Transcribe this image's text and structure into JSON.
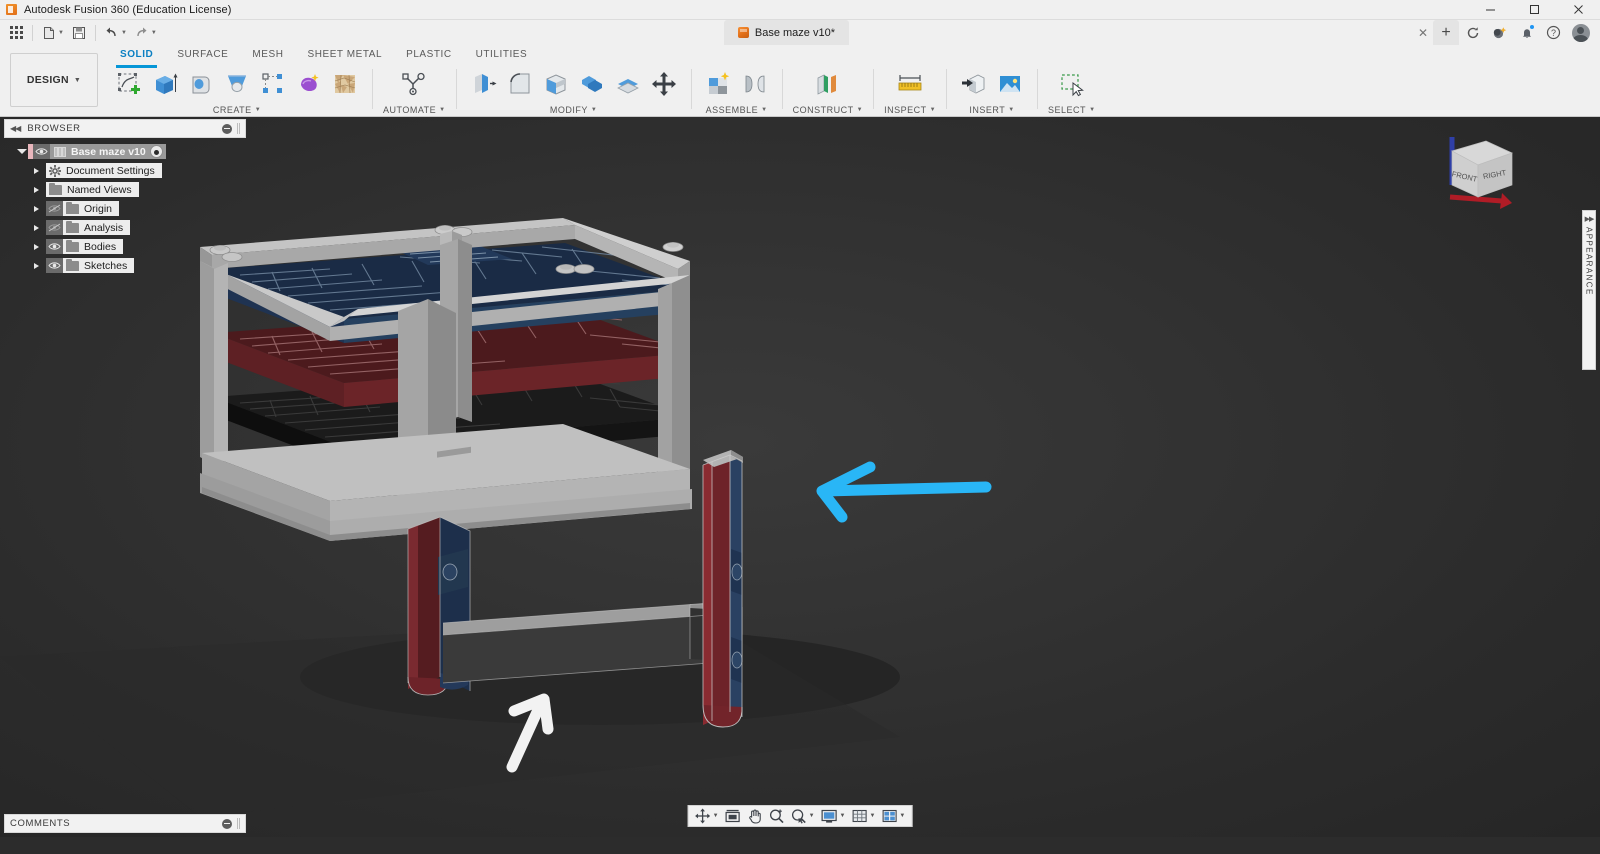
{
  "window": {
    "title": "Autodesk Fusion 360 (Education License)",
    "app_icon": "fusion-cube-icon",
    "minimize": "─",
    "maximize": "□",
    "close": "✕"
  },
  "quick_access": {
    "grid_icon": "app-grid-icon",
    "new_icon": "new-document-icon",
    "save_icon": "save-icon",
    "undo_icon": "undo-icon",
    "redo_icon": "redo-icon",
    "caret": "▼"
  },
  "document_tab": {
    "label": "Base maze v10*",
    "icon": "fusion-cube-icon",
    "close": "✕",
    "new_tab": "+"
  },
  "header_icons": [
    {
      "name": "refresh-icon",
      "label": "Refresh"
    },
    {
      "name": "extensions-icon",
      "label": "Extensions"
    },
    {
      "name": "notifications-bell-icon",
      "label": "Notifications",
      "badge": true
    },
    {
      "name": "help-icon",
      "label": "Help"
    },
    {
      "name": "user-avatar",
      "label": "Account"
    }
  ],
  "workspace_switcher": {
    "label": "DESIGN",
    "caret": "▼"
  },
  "ribbon": {
    "tabs": [
      {
        "label": "SOLID",
        "active": true
      },
      {
        "label": "SURFACE",
        "active": false
      },
      {
        "label": "MESH",
        "active": false
      },
      {
        "label": "SHEET METAL",
        "active": false
      },
      {
        "label": "PLASTIC",
        "active": false
      },
      {
        "label": "UTILITIES",
        "active": false
      }
    ],
    "panels": [
      {
        "label": "CREATE",
        "caret": "▼",
        "tools": [
          {
            "name": "create-sketch-icon"
          },
          {
            "name": "extrude-icon"
          },
          {
            "name": "revolve-icon"
          },
          {
            "name": "loft-icon"
          },
          {
            "name": "pattern-icon"
          },
          {
            "name": "create-form-icon"
          },
          {
            "name": "create-mesh-icon"
          }
        ]
      },
      {
        "label": "AUTOMATE",
        "caret": "▼",
        "tools": [
          {
            "name": "automate-icon"
          }
        ]
      },
      {
        "label": "MODIFY",
        "caret": "▼",
        "tools": [
          {
            "name": "press-pull-icon"
          },
          {
            "name": "fillet-icon"
          },
          {
            "name": "shell-icon"
          },
          {
            "name": "combine-icon"
          },
          {
            "name": "offset-face-icon"
          },
          {
            "name": "move-copy-icon"
          }
        ]
      },
      {
        "label": "ASSEMBLE",
        "caret": "▼",
        "tools": [
          {
            "name": "new-component-icon"
          },
          {
            "name": "joint-icon"
          }
        ]
      },
      {
        "label": "CONSTRUCT",
        "caret": "▼",
        "tools": [
          {
            "name": "construct-plane-icon"
          }
        ]
      },
      {
        "label": "INSPECT",
        "caret": "▼",
        "tools": [
          {
            "name": "measure-icon"
          }
        ]
      },
      {
        "label": "INSERT",
        "caret": "▼",
        "tools": [
          {
            "name": "insert-derive-icon"
          },
          {
            "name": "insert-image-icon"
          }
        ]
      },
      {
        "label": "SELECT",
        "caret": "▼",
        "tools": [
          {
            "name": "select-window-icon"
          }
        ]
      }
    ]
  },
  "browser": {
    "title": "BROWSER",
    "collapse_icon": "◀◀",
    "minimize_icon": "panel-minimize-icon",
    "grip_icon": "panel-grip-icon",
    "root": {
      "label": "Base maze v10",
      "expanded": true,
      "visible": true,
      "icon": "component-icon",
      "activate_icon": "activate-radio-icon"
    },
    "items": [
      {
        "label": "Document Settings",
        "icon": "gear-icon",
        "visible": null,
        "expanded": false
      },
      {
        "label": "Named Views",
        "icon": "folder-icon",
        "visible": null,
        "expanded": false
      },
      {
        "label": "Origin",
        "icon": "folder-icon",
        "visible": false,
        "expanded": false
      },
      {
        "label": "Analysis",
        "icon": "folder-icon",
        "visible": false,
        "expanded": false
      },
      {
        "label": "Bodies",
        "icon": "folder-icon",
        "visible": true,
        "expanded": false
      },
      {
        "label": "Sketches",
        "icon": "folder-icon",
        "visible": true,
        "expanded": false
      }
    ]
  },
  "comments": {
    "title": "COMMENTS",
    "minimize_icon": "panel-minimize-icon",
    "grip_icon": "panel-grip-icon"
  },
  "appearance_panel": {
    "title": "APPEARANCE",
    "collapse_icon": "▶▶"
  },
  "view_cube": {
    "face_front": "FRONT",
    "face_right": "RIGHT",
    "axis_z_color": "#2f3fa8",
    "axis_x_color": "#b01c26"
  },
  "navbar": {
    "items": [
      {
        "name": "orbit-icon",
        "caret": "▼"
      },
      {
        "name": "fit-view-icon",
        "caret": ""
      },
      {
        "name": "pan-icon",
        "caret": ""
      },
      {
        "name": "zoom-icon",
        "caret": ""
      },
      {
        "name": "zoom-window-icon",
        "caret": "▼"
      },
      {
        "name": "display-settings-icon",
        "caret": "▼"
      },
      {
        "name": "grid-snaps-icon",
        "caret": "▼"
      },
      {
        "name": "viewport-layout-icon",
        "caret": "▼"
      }
    ]
  },
  "model": {
    "description": "Three-layer maze assembly on gray frame with detached red/blue rail part",
    "colors": {
      "frame_gray": "#9a9a9a",
      "frame_gray_dark": "#6f6f6f",
      "layer_blue": "#1f3352",
      "layer_red": "#5e1f22",
      "layer_black": "#151515",
      "background": "#323232"
    }
  },
  "annotations": [
    {
      "name": "cyan-arrow-annotation",
      "color": "#29b6f6",
      "points_to": "detached-rail-part"
    },
    {
      "name": "white-arrow-annotation",
      "color": "#f5f5f5",
      "points_to": "frame-leg-bottom"
    }
  ]
}
